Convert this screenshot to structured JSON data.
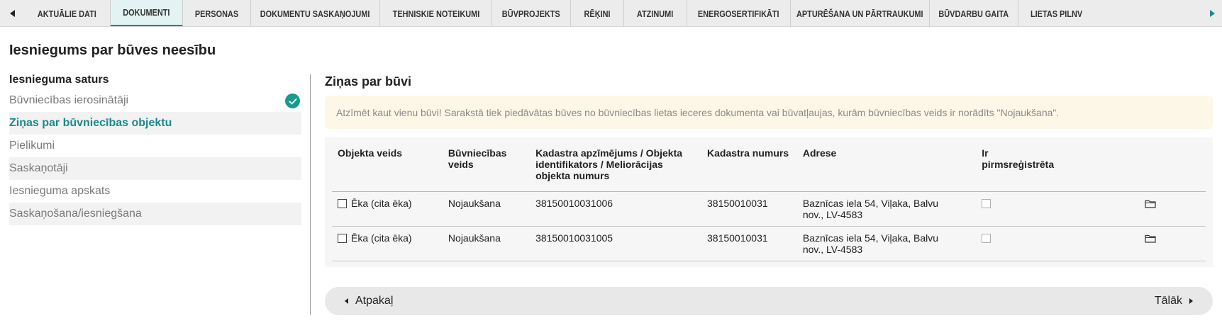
{
  "colors": {
    "accent": "#1a8a8a",
    "notice_bg": "#fcf7e6",
    "table_bg": "#f6f6f6",
    "check_badge": "#1a9a8e"
  },
  "tabs": [
    {
      "label": "AKTUĀLIE DATI",
      "active": false
    },
    {
      "label": "DOKUMENTI",
      "active": true
    },
    {
      "label": "PERSONAS",
      "active": false
    },
    {
      "label": "DOKUMENTU SASKAŅOJUMI",
      "active": false
    },
    {
      "label": "TEHNISKIE NOTEIKUMI",
      "active": false
    },
    {
      "label": "BŪVPROJEKTS",
      "active": false
    },
    {
      "label": "RĒĶINI",
      "active": false
    },
    {
      "label": "ATZINUMI",
      "active": false
    },
    {
      "label": "ENERGOSERTIFIKĀTI",
      "active": false
    },
    {
      "label": "APTURĒŠANA UN PĀRTRAUKUMI",
      "active": false
    },
    {
      "label": "BŪVDARBU GAITA",
      "active": false
    },
    {
      "label": "LIETAS PILNV",
      "active": false
    }
  ],
  "page_title": "Iesniegums par būves neesību",
  "left_nav": {
    "heading": "Iesnieguma saturs",
    "items": [
      {
        "label": "Būvniecības ierosinātāji",
        "state": "done"
      },
      {
        "label": "Ziņas par būvniecības objektu",
        "state": "active"
      },
      {
        "label": "Pielikumi",
        "state": "normal"
      },
      {
        "label": "Saskaņotāji",
        "state": "normal"
      },
      {
        "label": "Iesnieguma apskats",
        "state": "normal"
      },
      {
        "label": "Saskaņošana/iesniegšana",
        "state": "normal"
      }
    ]
  },
  "main": {
    "title": "Ziņas par būvi",
    "notice": "Atzīmēt kaut vienu būvi! Sarakstā tiek piedāvātas būves no būvniecības lietas ieceres dokumenta vai būvatļaujas, kurām būvniecības veids ir norādīts \"Nojaukšana\".",
    "table": {
      "headers": {
        "object_type": "Objekta veids",
        "construction_type": "Būvniecības veids",
        "cadastre_designation": "Kadastra apzīmējums / Objekta identifikators / Meliorācijas objekta numurs",
        "cadastre_number": "Kadastra numurs",
        "address": "Adrese",
        "pre_registered": "Ir pirmsreģistrēta"
      },
      "rows": [
        {
          "object_type": "Ēka (cita ēka)",
          "construction_type": "Nojaukšana",
          "cadastre_designation": "38150010031006",
          "cadastre_number": "38150010031",
          "address": "Baznīcas iela 54, Viļaka, Balvu nov., LV-4583"
        },
        {
          "object_type": "Ēka (cita ēka)",
          "construction_type": "Nojaukšana",
          "cadastre_designation": "38150010031005",
          "cadastre_number": "38150010031",
          "address": "Baznīcas iela 54, Viļaka, Balvu nov., LV-4583"
        }
      ]
    }
  },
  "pager": {
    "back_label": "Atpakaļ",
    "next_label": "Tālāk"
  }
}
